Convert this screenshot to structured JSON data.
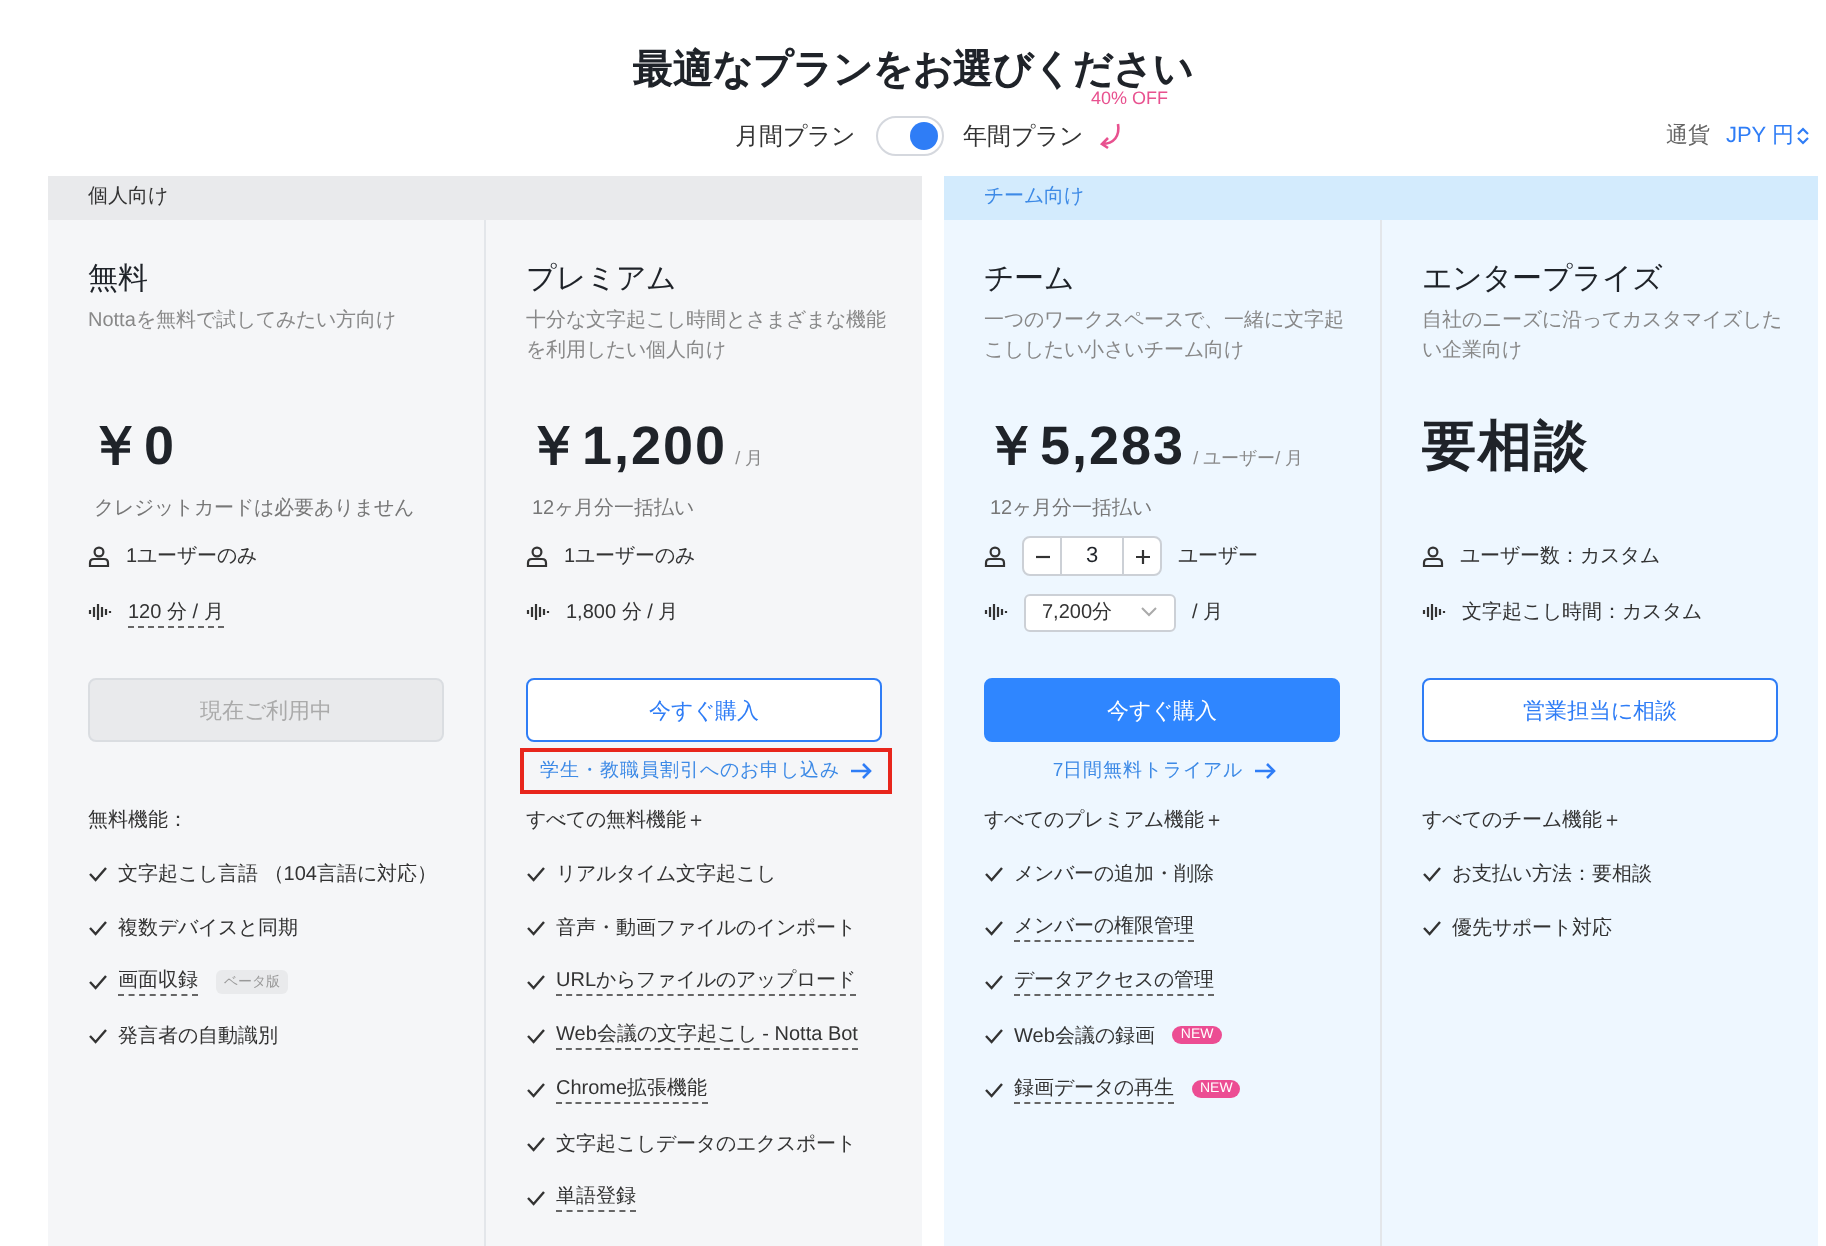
{
  "title": "最適なプランをお選びください",
  "billing": {
    "monthly_label": "月間プラン",
    "yearly_label": "年間プラン",
    "yearly_selected": true,
    "discount": "40% OFF"
  },
  "currency": {
    "label": "通貨",
    "value": "JPY 円"
  },
  "groups": [
    {
      "label": "個人向け",
      "kind": "personal",
      "plans": [
        {
          "name": "無料",
          "description": "Nottaを無料で試してみたい方向け",
          "price": "￥0",
          "price_note": "クレジットカードは必要ありません",
          "users": {
            "kind": "text",
            "text": "1ユーザーのみ"
          },
          "minutes": {
            "kind": "text",
            "text": "120 分 / 月",
            "underlined": true
          },
          "button": {
            "label": "現在ご利用中",
            "kind": "disabled"
          },
          "features_heading": "無料機能：",
          "features": [
            {
              "text": "文字起こし言語 （104言語に対応）",
              "underlined": false
            },
            {
              "text": "複数デバイスと同期",
              "underlined": false
            },
            {
              "text": "画面収録",
              "underlined": true,
              "badge": {
                "kind": "beta",
                "text": "ベータ版"
              }
            },
            {
              "text": "発言者の自動識別",
              "underlined": false
            }
          ]
        },
        {
          "name": "プレミアム",
          "description": "十分な文字起こし時間とさまざまな機能を利用したい個人向け",
          "price": "￥1,200",
          "price_unit": "/ 月",
          "price_note": "12ヶ月分一括払い",
          "users": {
            "kind": "text",
            "text": "1ユーザーのみ"
          },
          "minutes": {
            "kind": "text",
            "text": "1,800 分 / 月",
            "underlined": false
          },
          "button": {
            "label": "今すぐ購入",
            "kind": "outline"
          },
          "link": {
            "label": "学生・教職員割引へのお申し込み",
            "highlighted": true
          },
          "features_heading": "すべての無料機能＋",
          "features": [
            {
              "text": "リアルタイム文字起こし",
              "underlined": false
            },
            {
              "text": "音声・動画ファイルのインポート",
              "underlined": false
            },
            {
              "text": "URLからファイルのアップロード",
              "underlined": true
            },
            {
              "text": "Web会議の文字起こし - Notta Bot",
              "underlined": true
            },
            {
              "text": "Chrome拡張機能",
              "underlined": true
            },
            {
              "text": "文字起こしデータのエクスポート",
              "underlined": false
            },
            {
              "text": "単語登録",
              "underlined": true
            }
          ]
        }
      ]
    },
    {
      "label": "チーム向け",
      "kind": "team",
      "plans": [
        {
          "name": "チーム",
          "description": "一つのワークスペースで、一緒に文字起こししたい小さいチーム向け",
          "price": "￥5,283",
          "price_unit": "/ ユーザー/ 月",
          "price_note": "12ヶ月分一括払い",
          "users": {
            "kind": "stepper",
            "value": "3",
            "unit": "ユーザー"
          },
          "minutes": {
            "kind": "select",
            "value": "7,200分",
            "unit": "/ 月"
          },
          "button": {
            "label": "今すぐ購入",
            "kind": "primary"
          },
          "link": {
            "label": "7日間無料トライアル",
            "highlighted": false
          },
          "features_heading": "すべてのプレミアム機能＋",
          "features": [
            {
              "text": "メンバーの追加・削除",
              "underlined": false
            },
            {
              "text": "メンバーの権限管理",
              "underlined": true
            },
            {
              "text": "データアクセスの管理",
              "underlined": true
            },
            {
              "text": "Web会議の録画",
              "underlined": false,
              "badge": {
                "kind": "new",
                "text": "NEW"
              }
            },
            {
              "text": "録画データの再生",
              "underlined": true,
              "badge": {
                "kind": "new",
                "text": "NEW"
              }
            }
          ]
        },
        {
          "name": "エンタープライズ",
          "description": "自社のニーズに沿ってカスタマイズしたい企業向け",
          "price": "要相談",
          "users": {
            "kind": "text",
            "text": "ユーザー数：カスタム"
          },
          "minutes": {
            "kind": "text",
            "text": "文字起こし時間：カスタム",
            "underlined": false
          },
          "button": {
            "label": "営業担当に相談",
            "kind": "outline"
          },
          "features_heading": "すべてのチーム機能＋",
          "features": [
            {
              "text": "お支払い方法：要相談",
              "underlined": false
            },
            {
              "text": "優先サポート対応",
              "underlined": false
            }
          ]
        }
      ]
    }
  ]
}
